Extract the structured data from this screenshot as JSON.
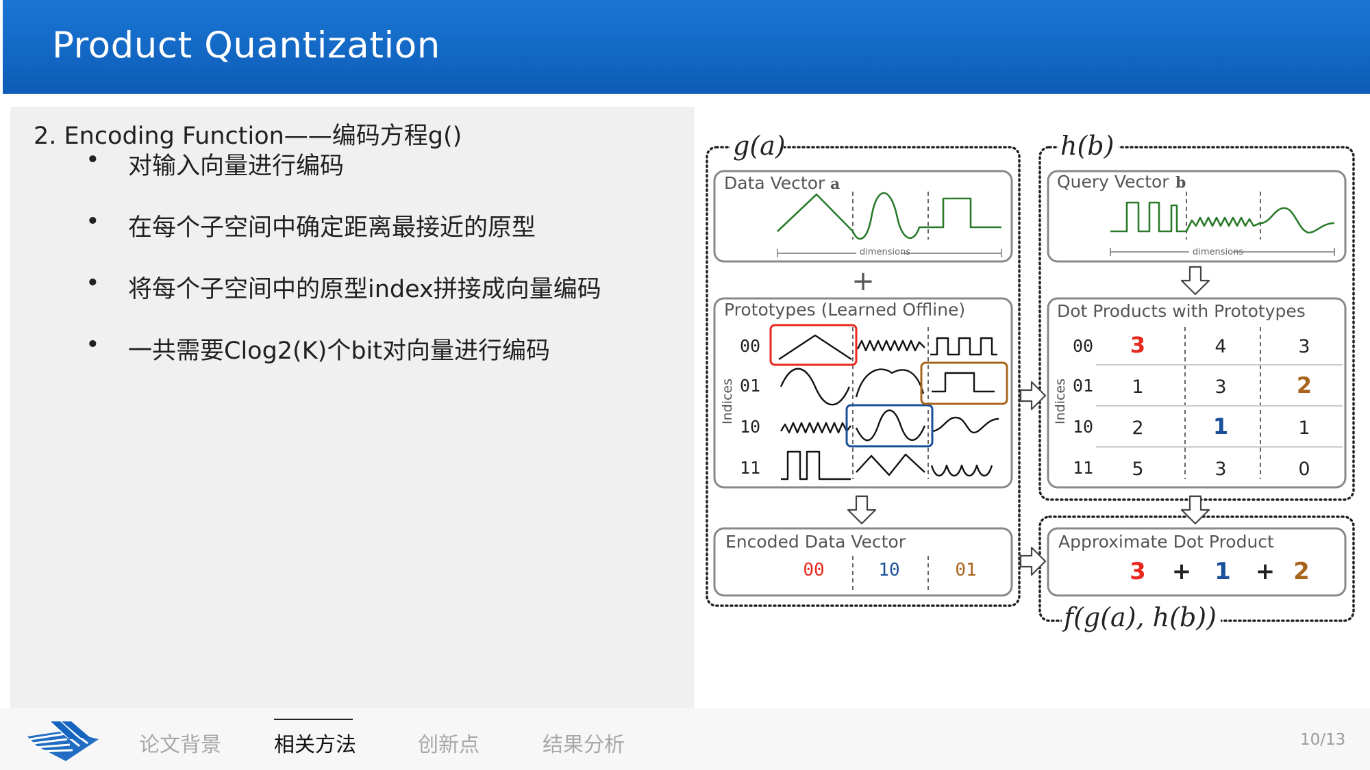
{
  "header": {
    "title": "Product Quantization"
  },
  "content": {
    "heading": "2.  Encoding Function——编码方程g()",
    "bullets": [
      "对输入向量进行编码",
      "在每个子空间中确定距离最接近的原型",
      "将每个子空间中的原型index拼接成向量编码",
      "一共需要Clog2(K)个bit对向量进行编码"
    ]
  },
  "figure": {
    "g_label": "g(a)",
    "h_label": "h(b)",
    "f_label": "f(g(a), h(b))",
    "data_vector_title": "Data Vector",
    "data_vector_var": "a",
    "query_vector_title": "Query Vector",
    "query_vector_var": "b",
    "dimensions_label": "dimensions",
    "plus": "+",
    "prototypes_title": "Prototypes (Learned Offline)",
    "indices_label": "Indices",
    "index_codes": [
      "00",
      "01",
      "10",
      "11"
    ],
    "dot_products_title": "Dot Products with Prototypes",
    "dot_table": [
      [
        "3",
        "4",
        "3"
      ],
      [
        "1",
        "3",
        "2"
      ],
      [
        "2",
        "1",
        "1"
      ],
      [
        "5",
        "3",
        "0"
      ]
    ],
    "encoded_title": "Encoded Data Vector",
    "encoded_codes": [
      "00",
      "10",
      "01"
    ],
    "approx_title": "Approximate Dot Product",
    "approx_terms": [
      "3",
      "1",
      "2"
    ],
    "colors": {
      "red": "#e8281e",
      "blue": "#1a4f99",
      "brown": "#a8641a"
    }
  },
  "footer": {
    "nav": [
      "论文背景",
      "相关方法",
      "创新点",
      "结果分析"
    ],
    "active_index": 1,
    "page": "10/13"
  }
}
